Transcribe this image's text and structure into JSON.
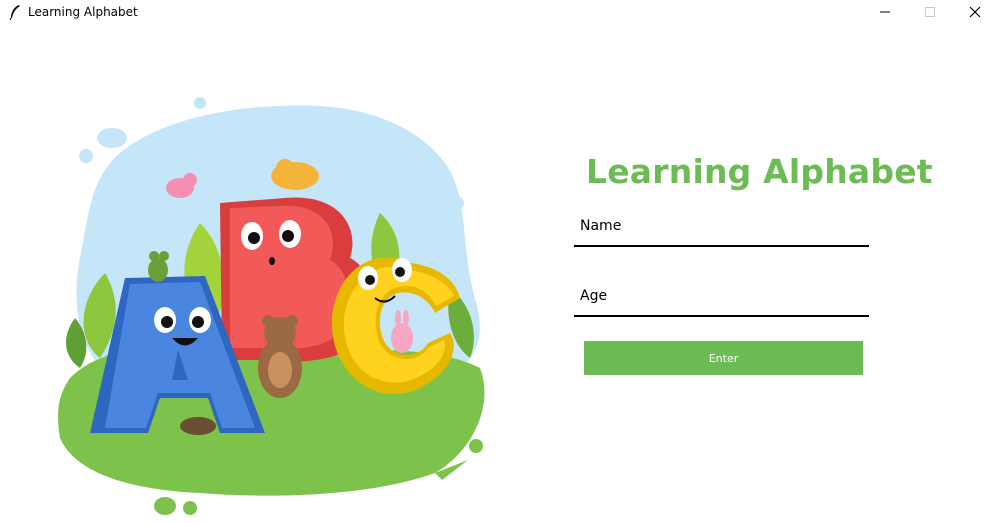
{
  "window": {
    "title": "Learning Alphabet",
    "icon": "feather-icon",
    "controls": [
      "minimize-icon",
      "maximize-icon",
      "close-icon"
    ]
  },
  "illustration": {
    "letters": [
      "A",
      "B",
      "C"
    ],
    "colors": {
      "letter_a": "#4a86df",
      "letter_b": "#f25a5a",
      "letter_c": "#ffd21f",
      "sky_blob": "#c5e5f8",
      "grass": "#7dc24a"
    }
  },
  "form": {
    "heading": "Learning Alphabet",
    "name_placeholder": "Name",
    "age_placeholder": "Age",
    "enter_label": "Enter"
  },
  "colors": {
    "accent": "#6cbb54",
    "underline": "#000000",
    "background": "#ffffff"
  }
}
